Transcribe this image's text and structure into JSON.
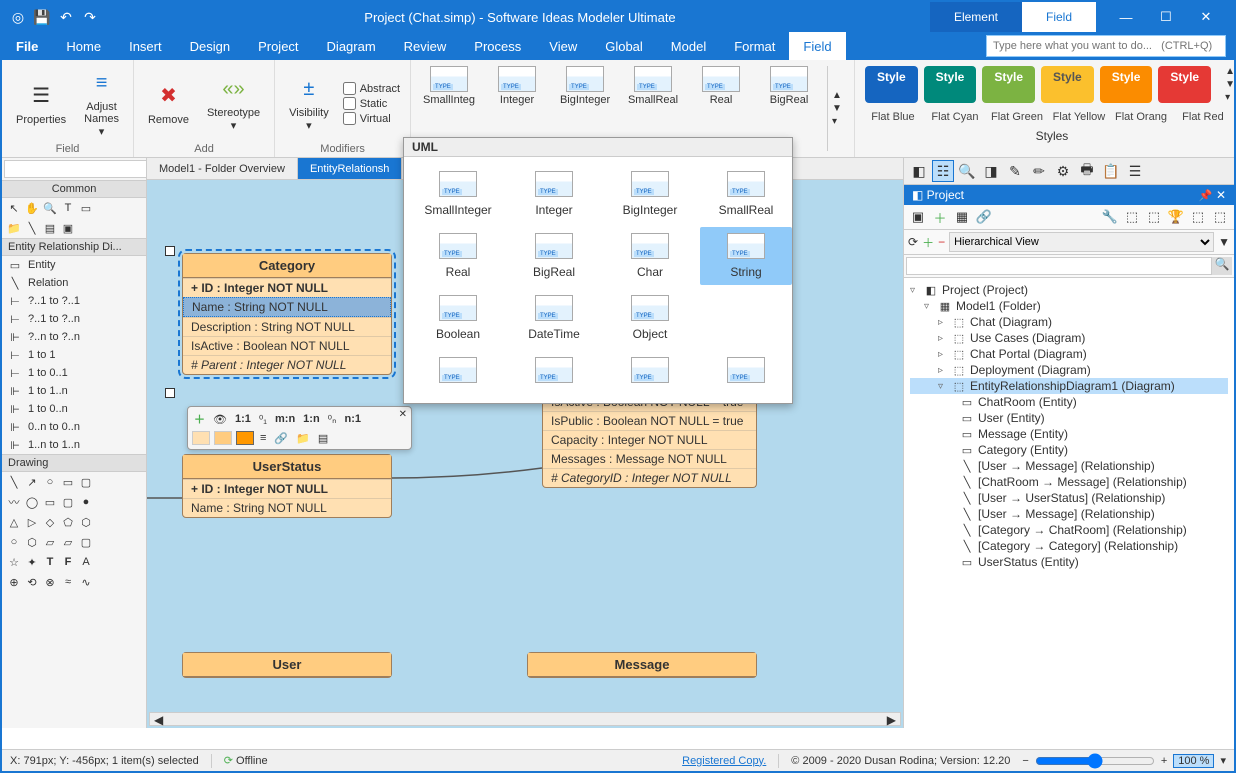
{
  "title": "Project (Chat.simp)  -  Software Ideas Modeler Ultimate",
  "title_tabs": {
    "element": "Element",
    "field": "Field"
  },
  "win_controls": {
    "min": "—",
    "max": "☐",
    "close": "✕"
  },
  "menu": [
    "File",
    "Home",
    "Insert",
    "Design",
    "Project",
    "Diagram",
    "Review",
    "Process",
    "View",
    "Global",
    "Model",
    "Format",
    "Field"
  ],
  "search_placeholder": "Type here what you want to do...   (CTRL+Q)",
  "ribbon": {
    "properties": "Properties",
    "adjust_names": "Adjust\nNames",
    "remove": "Remove",
    "stereotype": "Stereotype",
    "visibility": "Visibility",
    "abstract": "Abstract",
    "static": "Static",
    "virtual": "Virtual",
    "group_field": "Field",
    "group_add": "Add",
    "group_modifiers": "Modifiers",
    "types": [
      "SmallInteg",
      "Integer",
      "BigInteger",
      "SmallReal",
      "Real",
      "BigReal"
    ],
    "styles_label": "Styles",
    "style_btns": [
      {
        "label": "Style",
        "color": "#1565c0"
      },
      {
        "label": "Style",
        "color": "#00897b"
      },
      {
        "label": "Style",
        "color": "#7cb342"
      },
      {
        "label": "Style",
        "color": "#fbc02d"
      },
      {
        "label": "Style",
        "color": "#fb8c00"
      },
      {
        "label": "Style",
        "color": "#e53935"
      }
    ],
    "style_names": [
      "Flat Blue",
      "Flat Cyan",
      "Flat Green",
      "Flat Yellow",
      "Flat Orang",
      "Flat Red"
    ]
  },
  "doc_tabs": {
    "t1": "Model1 - Folder Overview",
    "t2": "EntityRelationsh"
  },
  "left": {
    "common": "Common",
    "erd": "Entity Relationship Di...",
    "entity": "Entity",
    "relation": "Relation",
    "rels": [
      "?..1 to ?..1",
      "?..1 to ?..n",
      "?..n to ?..n",
      "1 to 1",
      "1 to 0..1",
      "1 to 1..n",
      "1 to 0..n",
      "0..n to 0..n",
      "1..n to 1..n"
    ],
    "drawing": "Drawing"
  },
  "uml_popup": {
    "title": "UML",
    "items": [
      "SmallInteger",
      "Integer",
      "BigInteger",
      "SmallReal",
      "Real",
      "BigReal",
      "Char",
      "String",
      "Boolean",
      "DateTime",
      "Object"
    ],
    "selected": "String"
  },
  "entities": {
    "category": {
      "name": "Category",
      "rows": [
        {
          "text": "+ ID : Integer NOT NULL",
          "bold": true
        },
        {
          "text": "Name : String NOT NULL",
          "sel": true
        },
        {
          "text": "Description : String NOT NULL"
        },
        {
          "text": "IsActive : Boolean NOT NULL"
        },
        {
          "text": "# Parent : Integer NOT NULL",
          "italic": true
        }
      ]
    },
    "chatroom_partial": {
      "rows": [
        "IsActive : Boolean NOT NULL = true",
        "IsPublic : Boolean NOT NULL = true",
        "Capacity : Integer NOT NULL",
        "Messages : Message NOT NULL",
        "# CategoryID : Integer NOT NULL"
      ]
    },
    "userstatus": {
      "name": "UserStatus",
      "rows": [
        "+ ID : Integer NOT NULL",
        "Name : String NOT NULL"
      ]
    },
    "user": {
      "name": "User"
    },
    "message": {
      "name": "Message"
    }
  },
  "popup_tb": {
    "row1": [
      "＋",
      "👁",
      "1:1",
      "⁰₁",
      "m:n",
      "1:n",
      "⁰ₙ",
      "n:1"
    ]
  },
  "project": {
    "title": "Project",
    "view": "Hierarchical View",
    "root": "Project (Project)",
    "model": "Model1 (Folder)",
    "diagrams": [
      "Chat (Diagram)",
      "Use Cases (Diagram)",
      "Chat Portal (Diagram)",
      "Deployment (Diagram)"
    ],
    "erd": "EntityRelationshipDiagram1 (Diagram)",
    "erd_children": [
      "ChatRoom (Entity)",
      "User (Entity)",
      "Message (Entity)",
      "Category (Entity)",
      "[User → Message] (Relationship)",
      "[ChatRoom → Message] (Relationship)",
      "[User → UserStatus] (Relationship)",
      "[User → Message] (Relationship)",
      "[Category → ChatRoom] (Relationship)",
      "[Category → Category] (Relationship)",
      "UserStatus (Entity)"
    ]
  },
  "status": {
    "coords": "X: 791px; Y: -456px; 1 item(s) selected",
    "offline": "Offline",
    "reg": "Registered Copy.",
    "copyright": "© 2009 - 2020 Dusan Rodina; Version: 12.20",
    "zoom": "100 %"
  }
}
